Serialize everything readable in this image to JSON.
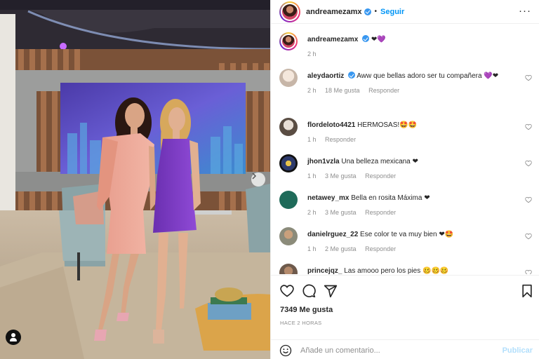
{
  "header": {
    "username": "andreamezamx",
    "separator": "•",
    "follow_label": "Seguir",
    "more_label": "···"
  },
  "caption": {
    "username": "andreamezamx",
    "emoji": "❤💜",
    "time": "2 h"
  },
  "comments": [
    {
      "username": "aleydaortiz",
      "verified": true,
      "text": "Aww que bellas adoro ser tu compañera",
      "emoji": "💜❤",
      "time": "2 h",
      "likes": "18 Me gusta",
      "reply": "Responder"
    },
    {
      "username": "flordeloto4421",
      "verified": false,
      "text": "HERMOSAS!🤩🤩",
      "emoji": "",
      "time": "1 h",
      "likes": "",
      "reply": "Responder"
    },
    {
      "username": "jhon1vzla",
      "verified": false,
      "text": "Una belleza mexicana",
      "emoji": "❤",
      "time": "1 h",
      "likes": "3 Me gusta",
      "reply": "Responder"
    },
    {
      "username": "netawey_mx",
      "verified": false,
      "text": "Bella en rosita Máxima",
      "emoji": "❤",
      "time": "2 h",
      "likes": "3 Me gusta",
      "reply": "Responder"
    },
    {
      "username": "danielrguez_22",
      "verified": false,
      "text": "Ese color te va muy bien",
      "emoji": "❤🤩",
      "time": "1 h",
      "likes": "2 Me gusta",
      "reply": "Responder"
    },
    {
      "username": "princejqz_",
      "verified": false,
      "text": "Las amooo pero los pies",
      "emoji": "🥴🥴🥴",
      "time": "",
      "likes": "",
      "reply": ""
    }
  ],
  "stats": {
    "likes": "7349 Me gusta",
    "ago": "HACE 2 HORAS"
  },
  "composer": {
    "placeholder": "Añade un comentario...",
    "post_label": "Publicar"
  },
  "icons": [
    "heart-icon",
    "comment-icon",
    "share-icon",
    "bookmark-icon",
    "emoji-icon",
    "user-tag-icon",
    "chevron-right-icon",
    "like-comment-icon"
  ],
  "colors": {
    "accent": "#0095f6",
    "verified": "#3897f0",
    "muted": "#8e8e8e",
    "heart": "#e0245e"
  }
}
